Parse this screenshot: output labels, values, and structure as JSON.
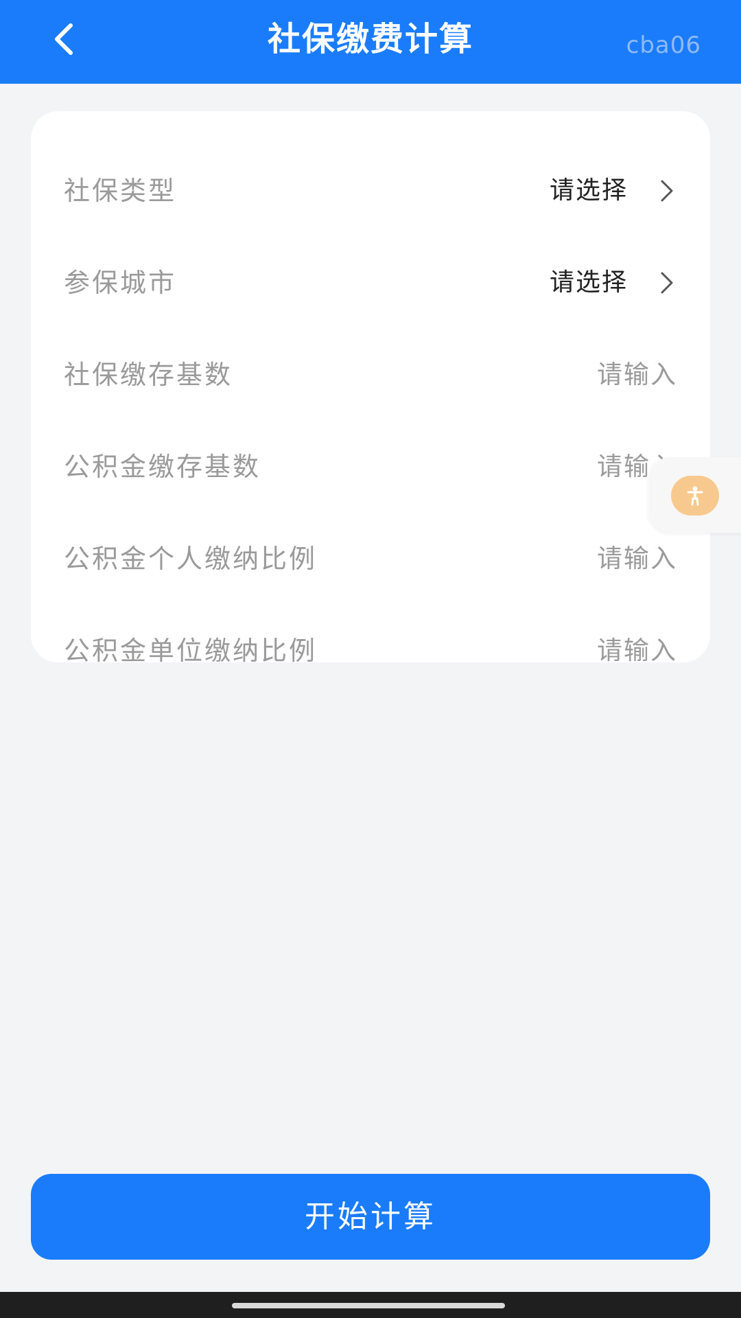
{
  "header": {
    "title": "社保缴费计算",
    "tag": "cba06",
    "back_icon": "chevron-left-icon",
    "background": "#1a7cfa"
  },
  "form": {
    "rows": [
      {
        "label": "社保类型",
        "value": "请选择",
        "kind": "select"
      },
      {
        "label": "参保城市",
        "value": "请选择",
        "kind": "select"
      },
      {
        "label": "社保缴存基数",
        "value": "请输入",
        "kind": "input"
      },
      {
        "label": "公积金缴存基数",
        "value": "请输入",
        "kind": "input"
      },
      {
        "label": "公积金个人缴纳比例",
        "value": "请输入",
        "kind": "input"
      },
      {
        "label": "公积金单位缴纳比例",
        "value": "请输入",
        "kind": "input"
      }
    ]
  },
  "floating": {
    "icon": "accessibility-icon",
    "color": "#f8c98e"
  },
  "actions": {
    "calculate_label": "开始计算",
    "color": "#1a7cfa"
  }
}
